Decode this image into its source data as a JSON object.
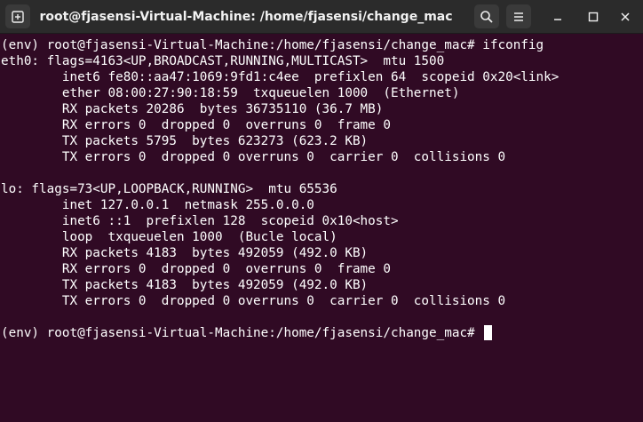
{
  "window": {
    "title": "root@fjasensi-Virtual-Machine: /home/fjasensi/change_mac",
    "icons": {
      "new_tab": "new-tab-icon",
      "search": "search-icon",
      "menu": "hamburger-menu-icon",
      "minimize": "minimize-icon",
      "maximize": "maximize-icon",
      "close": "close-icon"
    }
  },
  "colors": {
    "terminal_background": "#300a24",
    "text": "#ffffff",
    "titlebar": "#2b2b2b"
  },
  "terminal": {
    "lines": [
      "(env) root@fjasensi-Virtual-Machine:/home/fjasensi/change_mac# ifconfig",
      "eth0: flags=4163<UP,BROADCAST,RUNNING,MULTICAST>  mtu 1500",
      "        inet6 fe80::aa47:1069:9fd1:c4ee  prefixlen 64  scopeid 0x20<link>",
      "        ether 08:00:27:90:18:59  txqueuelen 1000  (Ethernet)",
      "        RX packets 20286  bytes 36735110 (36.7 MB)",
      "        RX errors 0  dropped 0  overruns 0  frame 0",
      "        TX packets 5795  bytes 623273 (623.2 KB)",
      "        TX errors 0  dropped 0 overruns 0  carrier 0  collisions 0",
      "",
      "lo: flags=73<UP,LOOPBACK,RUNNING>  mtu 65536",
      "        inet 127.0.0.1  netmask 255.0.0.0",
      "        inet6 ::1  prefixlen 128  scopeid 0x10<host>",
      "        loop  txqueuelen 1000  (Bucle local)",
      "        RX packets 4183  bytes 492059 (492.0 KB)",
      "        RX errors 0  dropped 0  overruns 0  frame 0",
      "        TX packets 4183  bytes 492059 (492.0 KB)",
      "        TX errors 0  dropped 0 overruns 0  carrier 0  collisions 0",
      "",
      "(env) root@fjasensi-Virtual-Machine:/home/fjasensi/change_mac# "
    ]
  }
}
